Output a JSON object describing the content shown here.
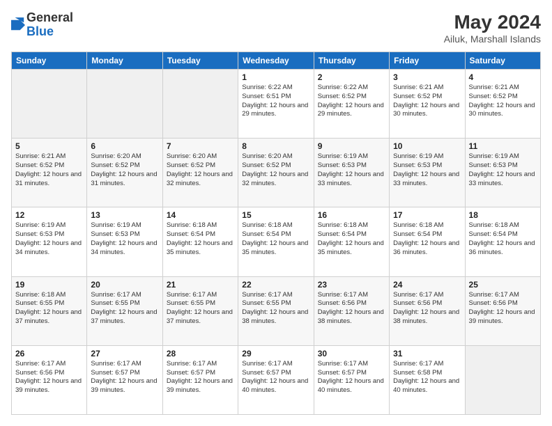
{
  "logo": {
    "general": "General",
    "blue": "Blue"
  },
  "header": {
    "month": "May 2024",
    "location": "Ailuk, Marshall Islands"
  },
  "weekdays": [
    "Sunday",
    "Monday",
    "Tuesday",
    "Wednesday",
    "Thursday",
    "Friday",
    "Saturday"
  ],
  "weeks": [
    [
      {
        "day": "",
        "info": ""
      },
      {
        "day": "",
        "info": ""
      },
      {
        "day": "",
        "info": ""
      },
      {
        "day": "1",
        "info": "Sunrise: 6:22 AM\nSunset: 6:51 PM\nDaylight: 12 hours and 29 minutes."
      },
      {
        "day": "2",
        "info": "Sunrise: 6:22 AM\nSunset: 6:52 PM\nDaylight: 12 hours and 29 minutes."
      },
      {
        "day": "3",
        "info": "Sunrise: 6:21 AM\nSunset: 6:52 PM\nDaylight: 12 hours and 30 minutes."
      },
      {
        "day": "4",
        "info": "Sunrise: 6:21 AM\nSunset: 6:52 PM\nDaylight: 12 hours and 30 minutes."
      }
    ],
    [
      {
        "day": "5",
        "info": "Sunrise: 6:21 AM\nSunset: 6:52 PM\nDaylight: 12 hours and 31 minutes."
      },
      {
        "day": "6",
        "info": "Sunrise: 6:20 AM\nSunset: 6:52 PM\nDaylight: 12 hours and 31 minutes."
      },
      {
        "day": "7",
        "info": "Sunrise: 6:20 AM\nSunset: 6:52 PM\nDaylight: 12 hours and 32 minutes."
      },
      {
        "day": "8",
        "info": "Sunrise: 6:20 AM\nSunset: 6:52 PM\nDaylight: 12 hours and 32 minutes."
      },
      {
        "day": "9",
        "info": "Sunrise: 6:19 AM\nSunset: 6:53 PM\nDaylight: 12 hours and 33 minutes."
      },
      {
        "day": "10",
        "info": "Sunrise: 6:19 AM\nSunset: 6:53 PM\nDaylight: 12 hours and 33 minutes."
      },
      {
        "day": "11",
        "info": "Sunrise: 6:19 AM\nSunset: 6:53 PM\nDaylight: 12 hours and 33 minutes."
      }
    ],
    [
      {
        "day": "12",
        "info": "Sunrise: 6:19 AM\nSunset: 6:53 PM\nDaylight: 12 hours and 34 minutes."
      },
      {
        "day": "13",
        "info": "Sunrise: 6:19 AM\nSunset: 6:53 PM\nDaylight: 12 hours and 34 minutes."
      },
      {
        "day": "14",
        "info": "Sunrise: 6:18 AM\nSunset: 6:54 PM\nDaylight: 12 hours and 35 minutes."
      },
      {
        "day": "15",
        "info": "Sunrise: 6:18 AM\nSunset: 6:54 PM\nDaylight: 12 hours and 35 minutes."
      },
      {
        "day": "16",
        "info": "Sunrise: 6:18 AM\nSunset: 6:54 PM\nDaylight: 12 hours and 35 minutes."
      },
      {
        "day": "17",
        "info": "Sunrise: 6:18 AM\nSunset: 6:54 PM\nDaylight: 12 hours and 36 minutes."
      },
      {
        "day": "18",
        "info": "Sunrise: 6:18 AM\nSunset: 6:54 PM\nDaylight: 12 hours and 36 minutes."
      }
    ],
    [
      {
        "day": "19",
        "info": "Sunrise: 6:18 AM\nSunset: 6:55 PM\nDaylight: 12 hours and 37 minutes."
      },
      {
        "day": "20",
        "info": "Sunrise: 6:17 AM\nSunset: 6:55 PM\nDaylight: 12 hours and 37 minutes."
      },
      {
        "day": "21",
        "info": "Sunrise: 6:17 AM\nSunset: 6:55 PM\nDaylight: 12 hours and 37 minutes."
      },
      {
        "day": "22",
        "info": "Sunrise: 6:17 AM\nSunset: 6:55 PM\nDaylight: 12 hours and 38 minutes."
      },
      {
        "day": "23",
        "info": "Sunrise: 6:17 AM\nSunset: 6:56 PM\nDaylight: 12 hours and 38 minutes."
      },
      {
        "day": "24",
        "info": "Sunrise: 6:17 AM\nSunset: 6:56 PM\nDaylight: 12 hours and 38 minutes."
      },
      {
        "day": "25",
        "info": "Sunrise: 6:17 AM\nSunset: 6:56 PM\nDaylight: 12 hours and 39 minutes."
      }
    ],
    [
      {
        "day": "26",
        "info": "Sunrise: 6:17 AM\nSunset: 6:56 PM\nDaylight: 12 hours and 39 minutes."
      },
      {
        "day": "27",
        "info": "Sunrise: 6:17 AM\nSunset: 6:57 PM\nDaylight: 12 hours and 39 minutes."
      },
      {
        "day": "28",
        "info": "Sunrise: 6:17 AM\nSunset: 6:57 PM\nDaylight: 12 hours and 39 minutes."
      },
      {
        "day": "29",
        "info": "Sunrise: 6:17 AM\nSunset: 6:57 PM\nDaylight: 12 hours and 40 minutes."
      },
      {
        "day": "30",
        "info": "Sunrise: 6:17 AM\nSunset: 6:57 PM\nDaylight: 12 hours and 40 minutes."
      },
      {
        "day": "31",
        "info": "Sunrise: 6:17 AM\nSunset: 6:58 PM\nDaylight: 12 hours and 40 minutes."
      },
      {
        "day": "",
        "info": ""
      }
    ]
  ]
}
